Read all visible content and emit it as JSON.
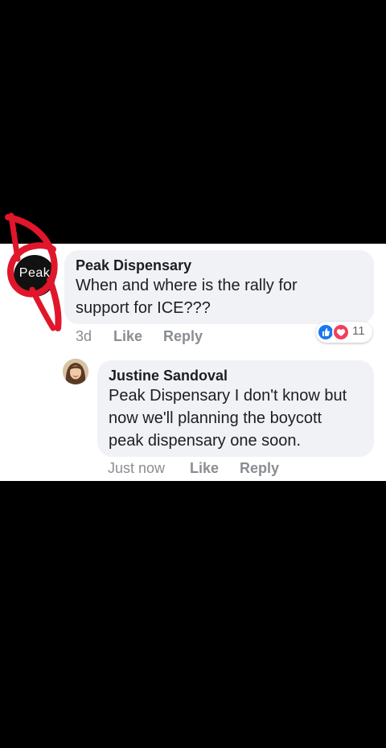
{
  "comment": {
    "author": "Peak Dispensary",
    "text_line1": "When and where is the rally for",
    "text_line2": "support for ICE???",
    "time": "3d",
    "like_label": "Like",
    "reply_label": "Reply",
    "reaction_count": "11",
    "avatar_logo_text": "Peak",
    "reaction_icons": [
      "like-icon",
      "love-icon"
    ]
  },
  "reply": {
    "author": "Justine Sandoval",
    "text_line1": "Peak Dispensary I don't know but",
    "text_line2": "now we'll planning the boycott",
    "text_line3": "peak dispensary one soon.",
    "time": "Just now",
    "like_label": "Like",
    "reply_label": "Reply"
  },
  "colors": {
    "bubble_bg": "#f0f2f5",
    "like_blue": "#1877f2",
    "love_red": "#f33e58",
    "annotation_red": "#e0162b",
    "meta_gray": "#8a8d91"
  }
}
